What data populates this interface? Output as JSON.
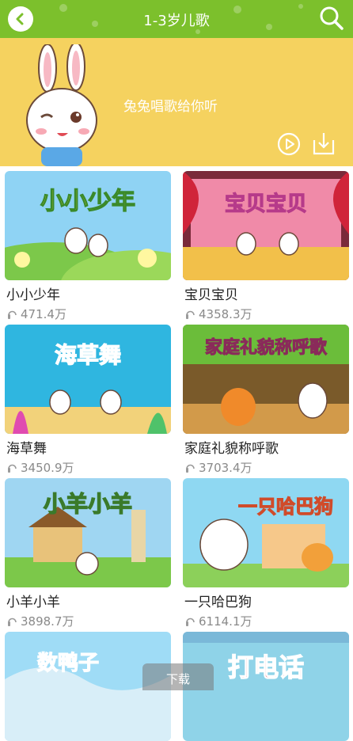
{
  "header": {
    "title": "1-3岁儿歌",
    "back_icon": "chevron-left-icon",
    "search_icon": "search-icon",
    "color": "#7cc02c"
  },
  "banner": {
    "text": "兔兔唱歌给你听",
    "play_icon": "play-circle-icon",
    "download_icon": "download-icon",
    "color": "#f5d25f"
  },
  "songs": [
    {
      "title": "小小少年",
      "count": "471.4万",
      "thumb_text": "小小少年"
    },
    {
      "title": "宝贝宝贝",
      "count": "4358.3万",
      "thumb_text": "宝贝宝贝"
    },
    {
      "title": "海草舞",
      "count": "3450.9万",
      "thumb_text": "海草舞"
    },
    {
      "title": "家庭礼貌称呼歌",
      "count": "3703.4万",
      "thumb_text": "家庭礼貌称呼歌"
    },
    {
      "title": "小羊小羊",
      "count": "3898.7万",
      "thumb_text": "小羊小羊"
    },
    {
      "title": "一只哈巴狗",
      "count": "6114.1万",
      "thumb_text": "一只哈巴狗"
    },
    {
      "title": "",
      "count": "",
      "thumb_text": "数鸭子"
    },
    {
      "title": "",
      "count": "",
      "thumb_text": "打电话"
    }
  ],
  "download_bar": {
    "label": "下载"
  }
}
